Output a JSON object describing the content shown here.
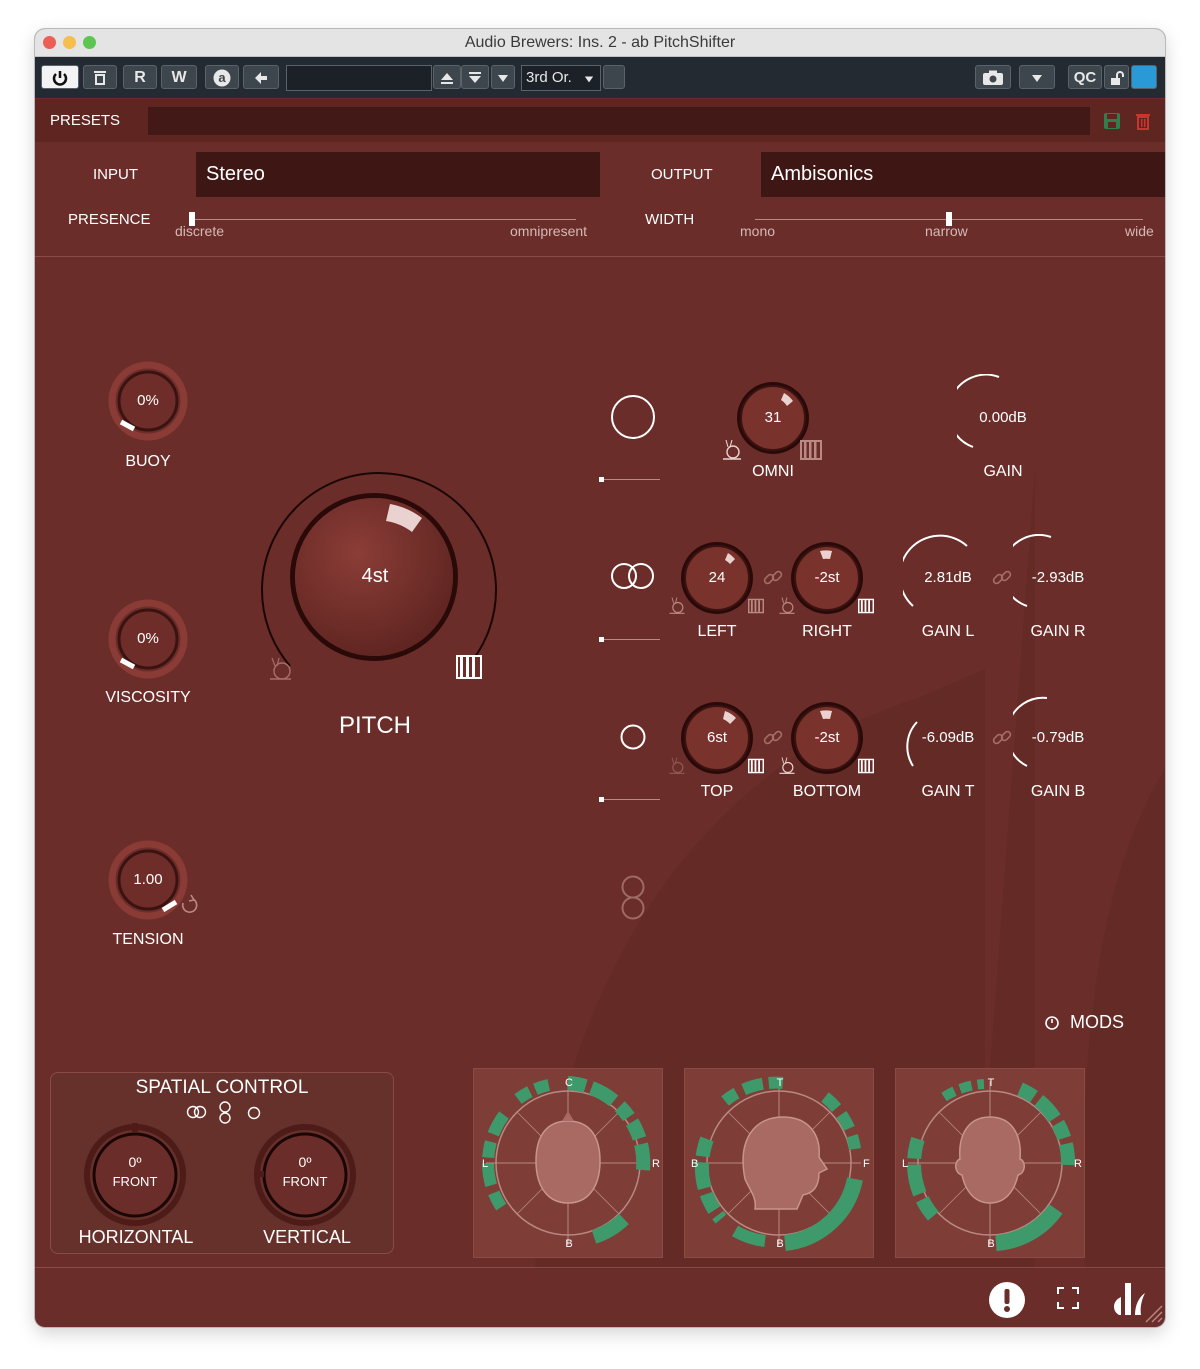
{
  "window": {
    "title": "Audio Brewers: Ins. 2 - ab PitchShifter"
  },
  "toolbar": {
    "r_label": "R",
    "w_label": "W",
    "order_label": "3rd Or.",
    "qc_label": "QC"
  },
  "presets": {
    "label": "PRESETS"
  },
  "io": {
    "input_label": "INPUT",
    "input_value": "Stereo",
    "output_label": "OUTPUT",
    "output_value": "Ambisonics",
    "presence_label": "PRESENCE",
    "presence_min": "discrete",
    "presence_max": "omnipresent",
    "presence_value": 0.0,
    "width_label": "WIDTH",
    "width_min": "mono",
    "width_mid": "narrow",
    "width_max": "wide",
    "width_value": 0.5
  },
  "knobs": {
    "buoy": {
      "value": "0%",
      "label": "BUOY"
    },
    "viscosity": {
      "value": "0%",
      "label": "VISCOSITY"
    },
    "tension": {
      "value": "1.00",
      "label": "TENSION"
    },
    "pitch": {
      "value": "4st",
      "label": "PITCH"
    },
    "omni": {
      "value": "31",
      "label": "OMNI"
    },
    "gain": {
      "value": "0.00dB",
      "label": "GAIN"
    },
    "left": {
      "value": "24",
      "label": "LEFT"
    },
    "right": {
      "value": "-2st",
      "label": "RIGHT"
    },
    "gain_l": {
      "value": "2.81dB",
      "label": "GAIN L"
    },
    "gain_r": {
      "value": "-2.93dB",
      "label": "GAIN R"
    },
    "top": {
      "value": "6st",
      "label": "TOP"
    },
    "bottom": {
      "value": "-2st",
      "label": "BOTTOM"
    },
    "gain_t": {
      "value": "-6.09dB",
      "label": "GAIN T"
    },
    "gain_b": {
      "value": "-0.79dB",
      "label": "GAIN B"
    }
  },
  "mods": {
    "label": "MODS"
  },
  "spatial": {
    "title": "SPATIAL CONTROL",
    "horizontal": {
      "value": "0º",
      "sub": "FRONT",
      "label": "HORIZONTAL"
    },
    "vertical": {
      "value": "0º",
      "sub": "FRONT",
      "label": "VERTICAL"
    }
  },
  "panels": [
    {
      "top": "C",
      "left": "L",
      "right": "R",
      "bottom": "B"
    },
    {
      "top": "T",
      "left": "B",
      "right": "F",
      "bottom": "B"
    },
    {
      "top": "T",
      "left": "L",
      "right": "R",
      "bottom": "B"
    }
  ],
  "colors": {
    "background": "#6a2d29",
    "accent_green": "#3f9a6b",
    "toolbar": "#232a31"
  }
}
